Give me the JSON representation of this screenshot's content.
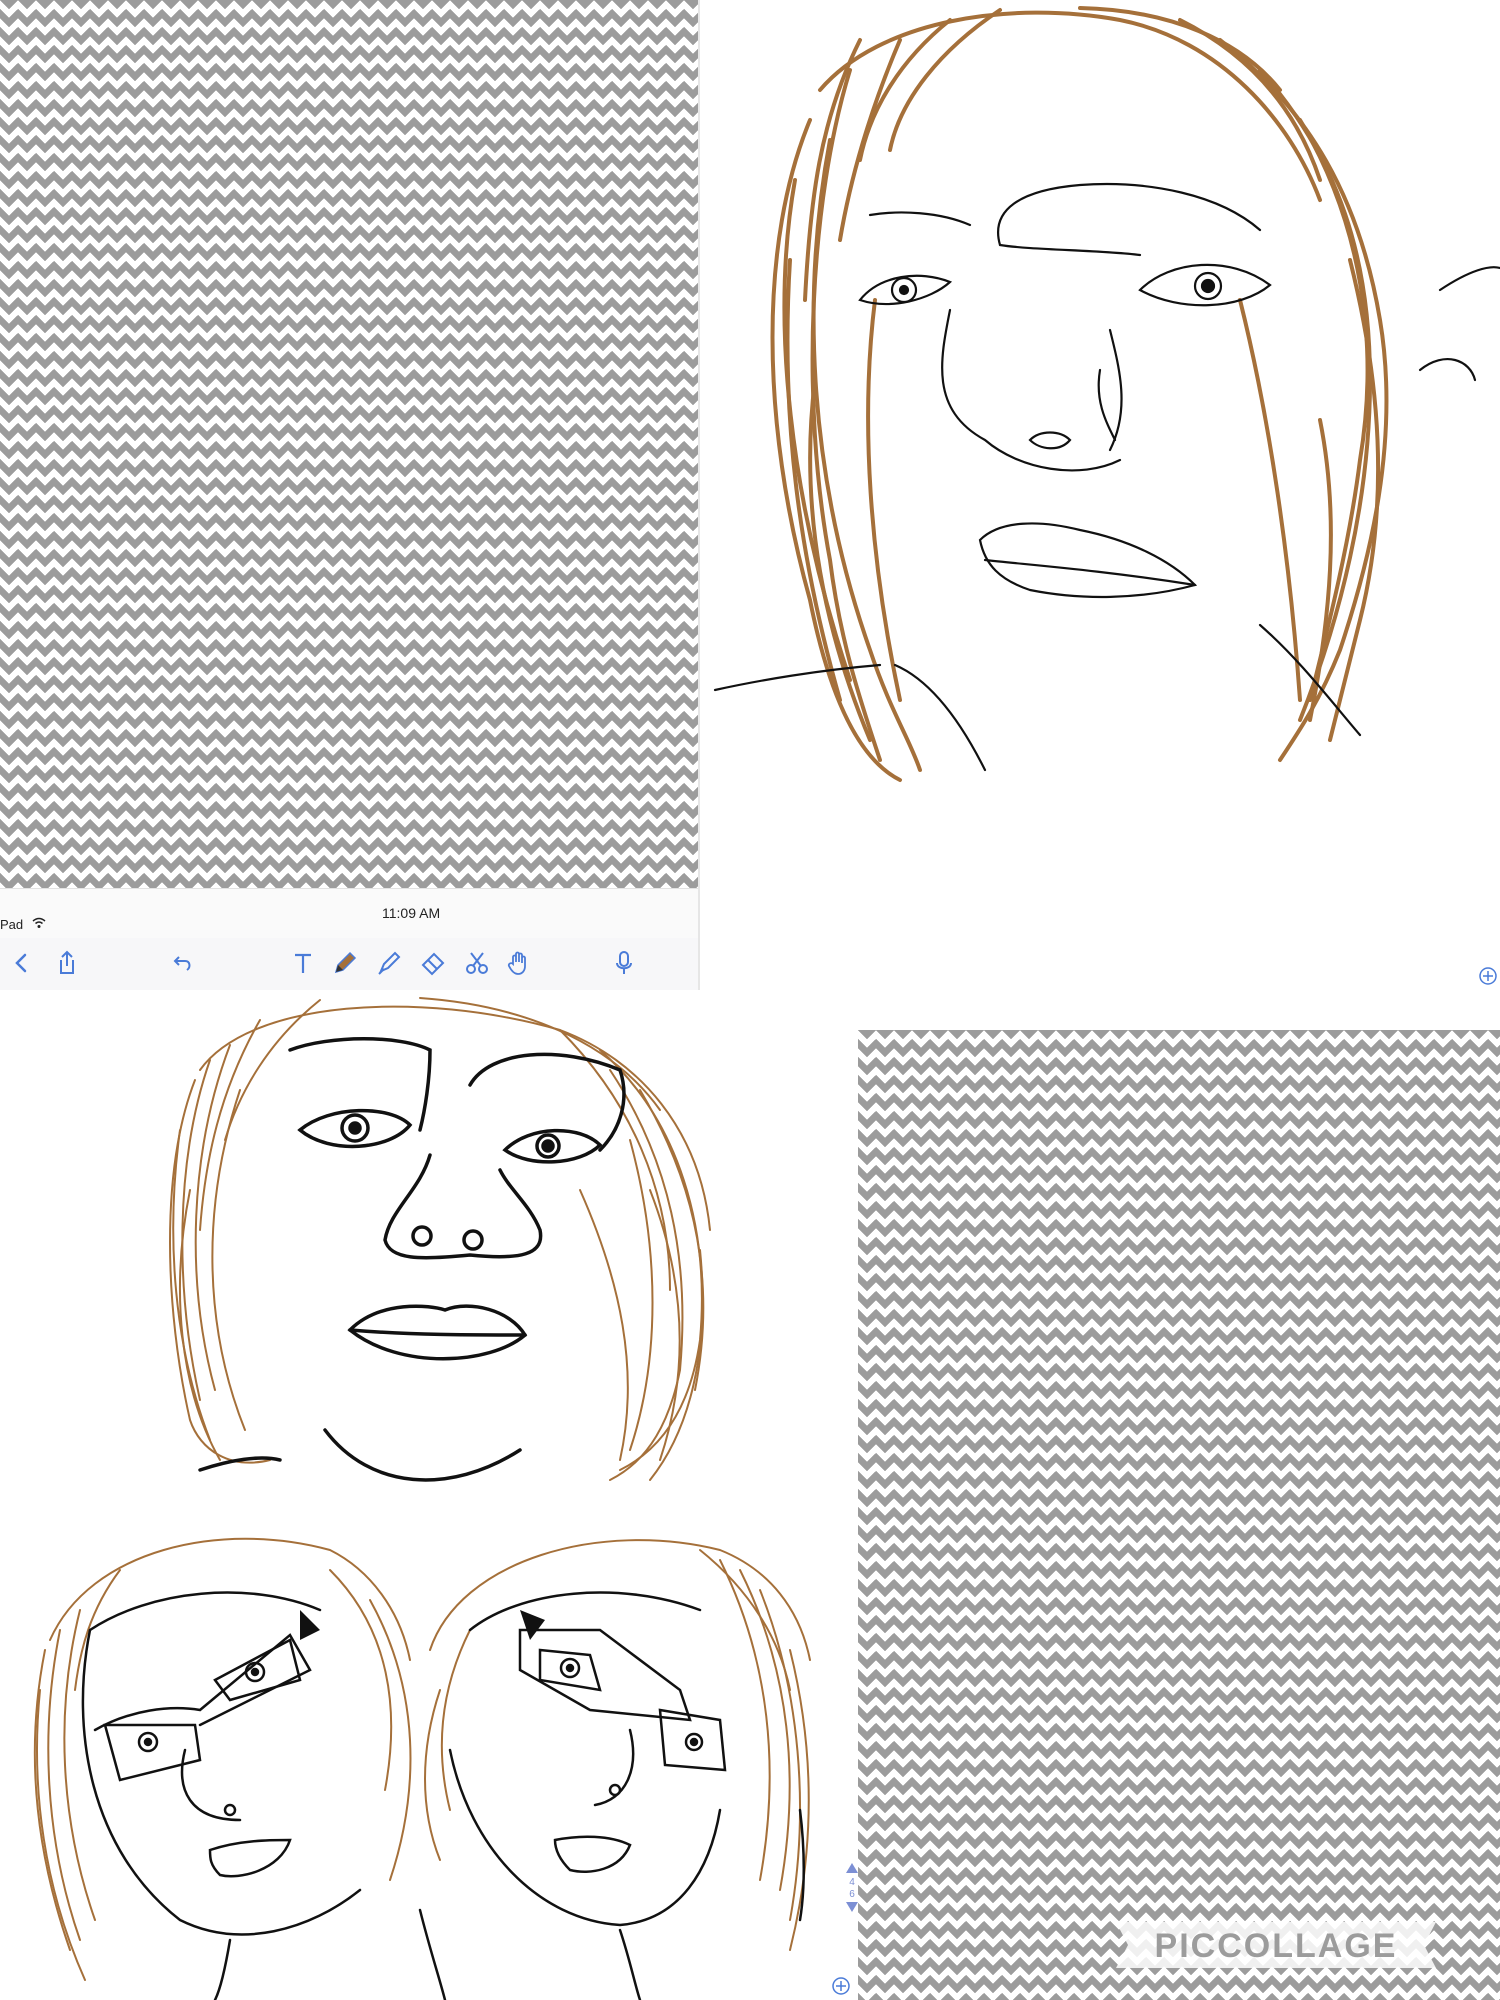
{
  "status_bar": {
    "device": "Pad",
    "time": "11:09 AM"
  },
  "toolbar": {
    "tools": [
      {
        "name": "back-icon"
      },
      {
        "name": "share-icon"
      },
      {
        "name": "undo-icon"
      },
      {
        "name": "text-tool-icon"
      },
      {
        "name": "pencil-tool-icon"
      },
      {
        "name": "highlighter-tool-icon"
      },
      {
        "name": "eraser-tool-icon"
      },
      {
        "name": "scissors-tool-icon"
      },
      {
        "name": "hand-tool-icon"
      },
      {
        "name": "microphone-icon"
      }
    ],
    "active_tool": "pencil-tool-icon"
  },
  "pager": {
    "current": "4",
    "total": "6"
  },
  "watermark": {
    "text": "PICCOLLAGE"
  },
  "colors": {
    "hair": "#a5703a",
    "accent": "#4a7bd8",
    "chevron": "#9c9c9c",
    "ink": "#111111"
  }
}
